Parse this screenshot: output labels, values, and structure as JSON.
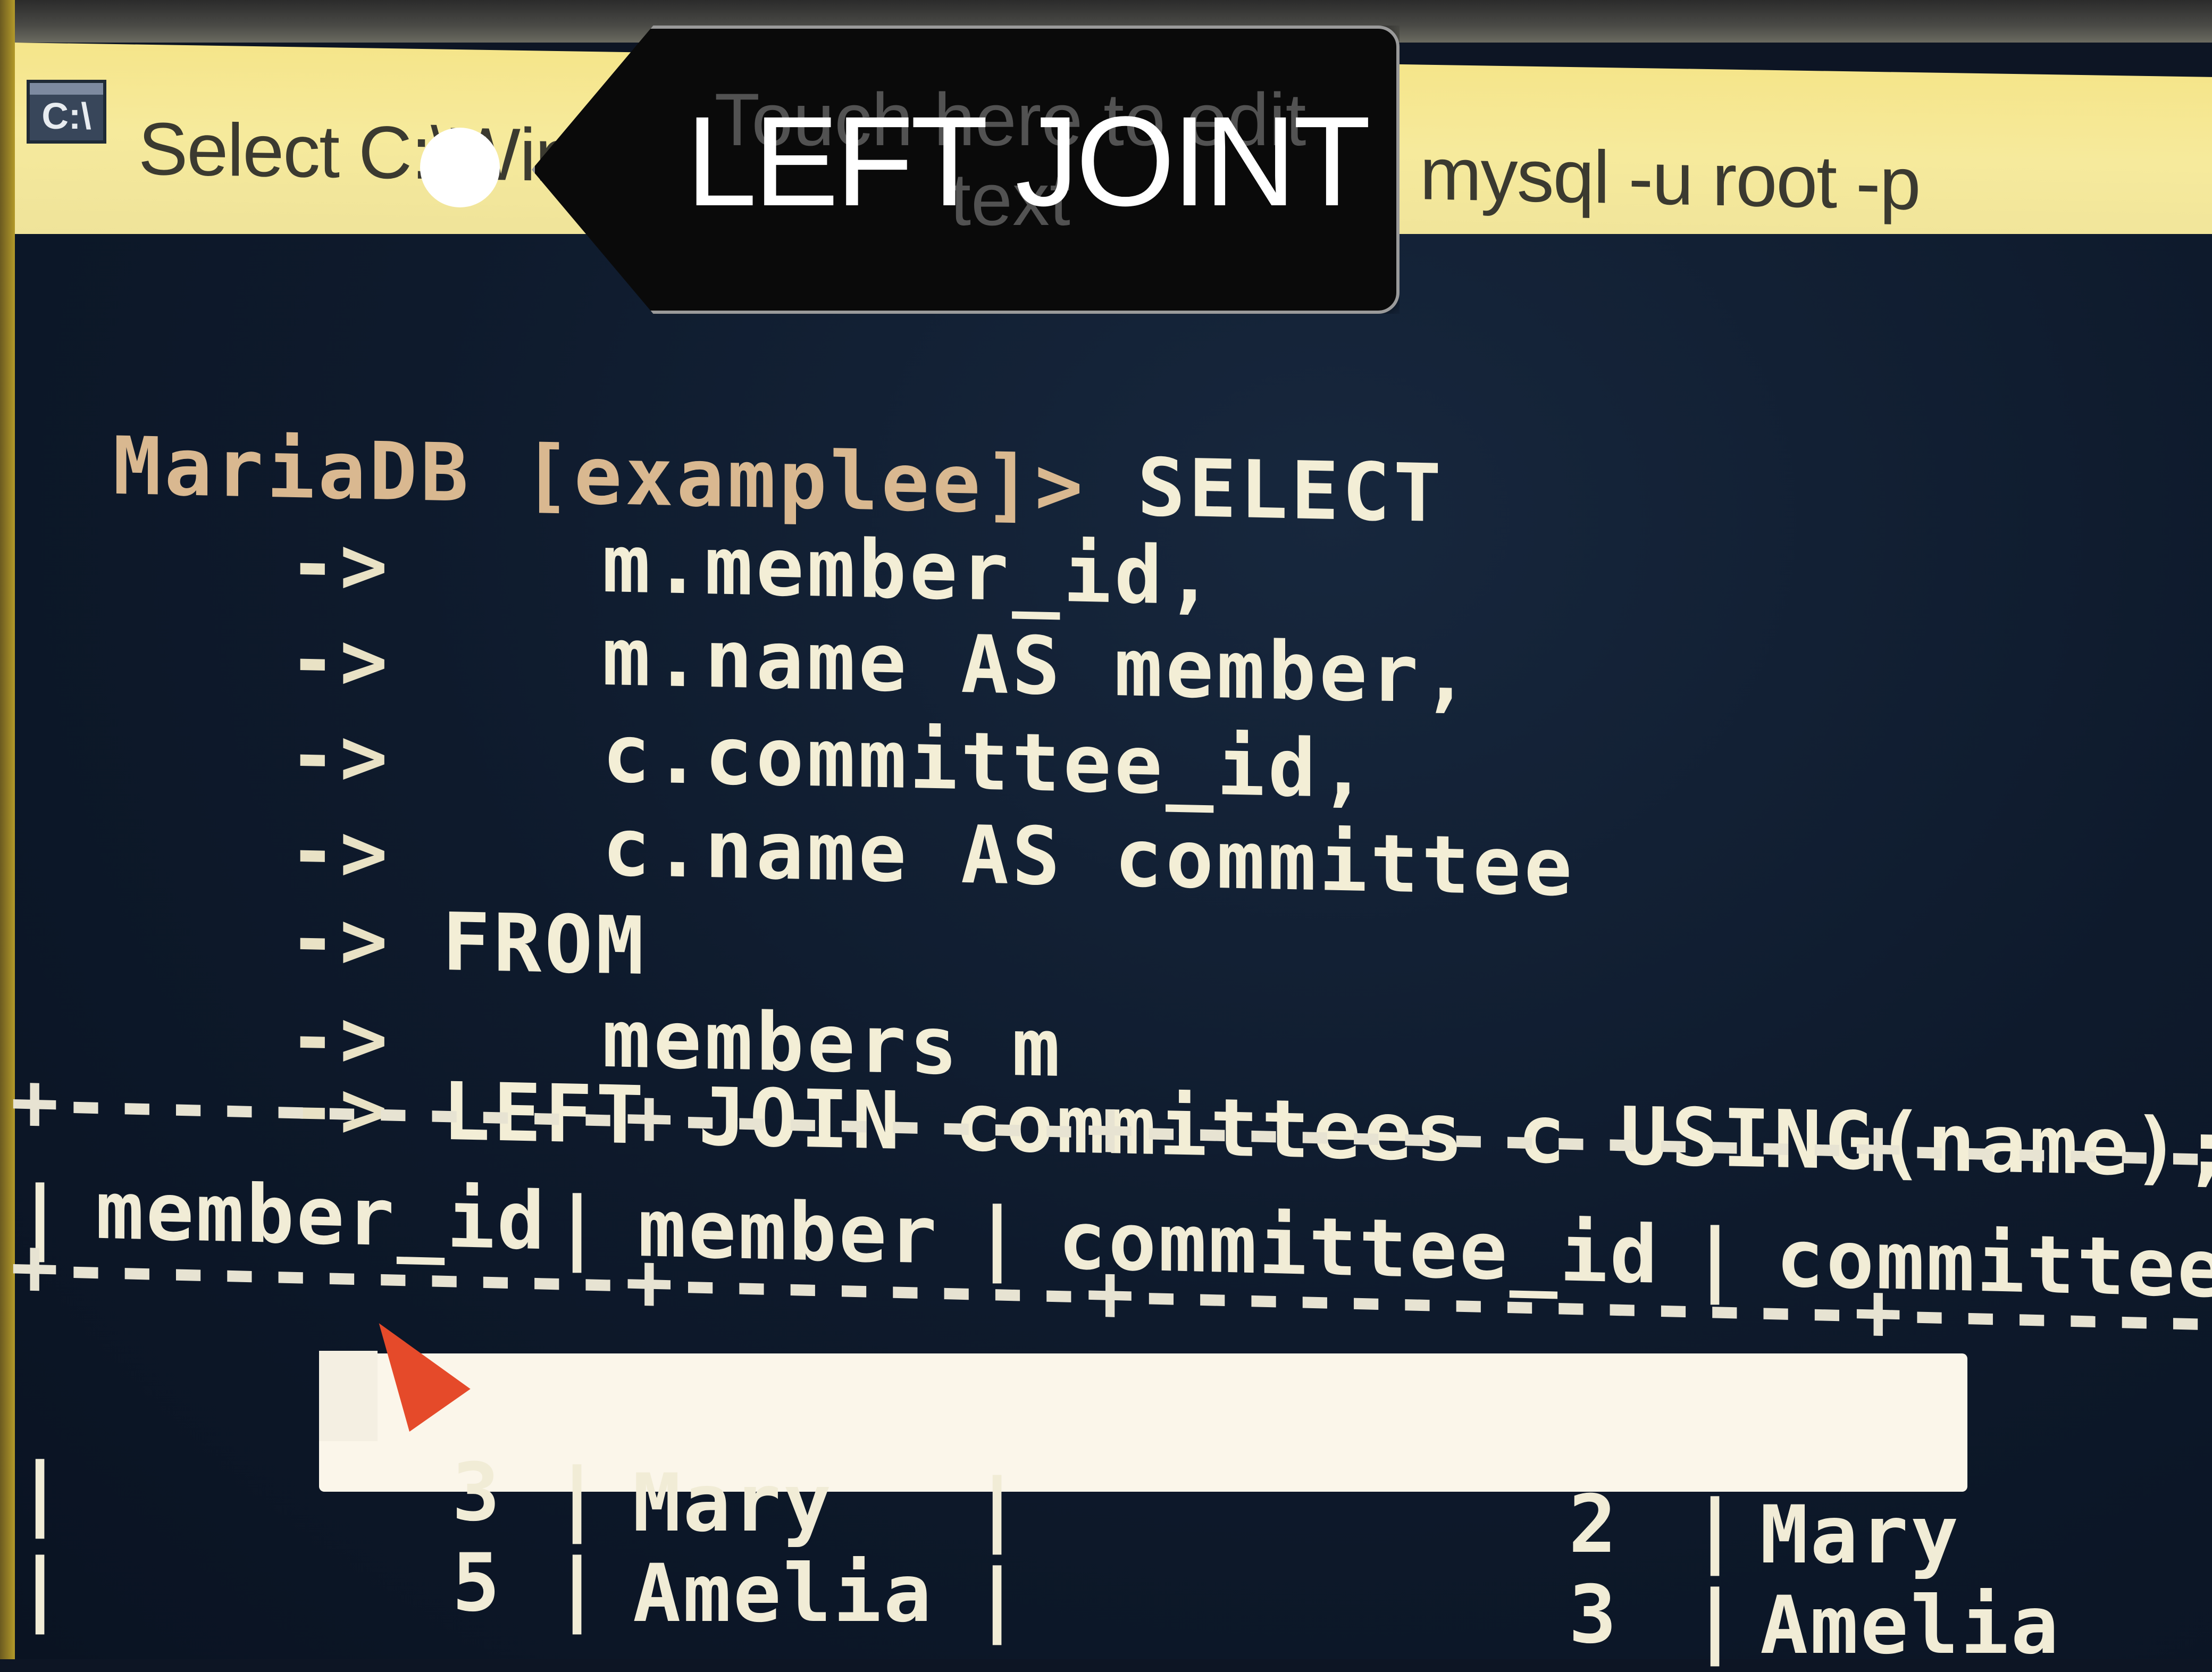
{
  "window": {
    "title_left": "Select C:\\Win",
    "title_right": "mysql  -u root -p"
  },
  "overlay": {
    "hint": "Touch here to edit text",
    "label": "LEFT JOINT"
  },
  "console": {
    "prompt": "MariaDB [examplee]>",
    "first_keyword": "SELECT",
    "continuation": "->",
    "lines": [
      "m.member_id,",
      "m.name AS member,",
      "c.committee_id,",
      "c.name AS committee",
      "FROM",
      "members m",
      "LEFT JOIN committees c USING(name);"
    ]
  },
  "result_table": {
    "separator": "+-----------+--------+--------------+----------",
    "headers": [
      "member_id",
      "member",
      "committee_id",
      "committee"
    ],
    "rows": [
      {
        "member_id": "3",
        "member": "Mary",
        "committee_id": "2",
        "committee": "Mary"
      },
      {
        "member_id": "5",
        "member": "Amelia",
        "committee_id": "3",
        "committee": "Amelia"
      }
    ]
  }
}
